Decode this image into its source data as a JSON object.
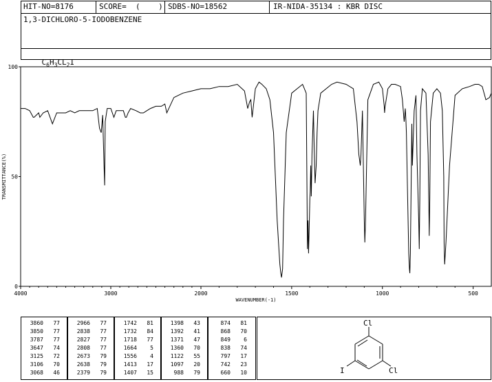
{
  "header": {
    "hit_no": "HIT-NO=8176",
    "score": "SCORE=  (    )",
    "sdbs_no": "SDBS-NO=18562",
    "ir_id": "IR-NIDA-35134 : KBR DISC",
    "compound_name": "1,3-DICHLORO-5-IODOBENZENE",
    "formula": "C6H3CL2I"
  },
  "chart_data": {
    "type": "line",
    "title": "",
    "xlabel": "WAVENUMBER(-1)",
    "ylabel": "TRANSMITTANCE(%)",
    "xlim": [
      4000,
      400
    ],
    "ylim": [
      0,
      100
    ],
    "x_ticks": [
      4000,
      3000,
      2000,
      1500,
      1000,
      500
    ],
    "y_ticks": [
      0,
      50,
      100
    ],
    "grid": false,
    "series": [
      {
        "x": [
          4000,
          3950,
          3900,
          3860,
          3850,
          3800,
          3787,
          3750,
          3700,
          3647,
          3600,
          3550,
          3500,
          3450,
          3400,
          3350,
          3300,
          3250,
          3200,
          3150,
          3125,
          3106,
          3090,
          3075,
          3068,
          3062,
          3040,
          3000,
          2966,
          2940,
          2900,
          2860,
          2838,
          2827,
          2808,
          2780,
          2720,
          2673,
          2638,
          2600,
          2560,
          2500,
          2440,
          2400,
          2379,
          2300,
          2200,
          2100,
          2000,
          1950,
          1900,
          1850,
          1800,
          1760,
          1742,
          1732,
          1725,
          1718,
          1700,
          1680,
          1664,
          1640,
          1620,
          1600,
          1580,
          1565,
          1560,
          1556,
          1550,
          1545,
          1530,
          1500,
          1470,
          1440,
          1420,
          1413,
          1410,
          1407,
          1404,
          1400,
          1398,
          1395,
          1392,
          1388,
          1380,
          1375,
          1371,
          1365,
          1360,
          1355,
          1340,
          1310,
          1280,
          1250,
          1200,
          1160,
          1140,
          1130,
          1125,
          1122,
          1118,
          1110,
          1100,
          1097,
          1093,
          1080,
          1050,
          1020,
          1000,
          990,
          988,
          985,
          970,
          950,
          930,
          900,
          890,
          880,
          874,
          870,
          868,
          862,
          855,
          851,
          849,
          846,
          840,
          838,
          835,
          825,
          815,
          810,
          800,
          797,
          794,
          790,
          780,
          760,
          748,
          744,
          742,
          739,
          735,
          720,
          700,
          680,
          670,
          662,
          660,
          657,
          650,
          630,
          600,
          560,
          520,
          490,
          470,
          450,
          430,
          410,
          400
        ],
        "y": [
          81,
          81,
          80,
          77,
          77,
          79,
          77,
          79,
          80,
          74,
          79,
          79,
          79,
          80,
          79,
          80,
          80,
          80,
          80,
          81,
          72,
          70,
          78,
          55,
          46,
          75,
          81,
          81,
          77,
          80,
          80,
          80,
          77,
          77,
          79,
          81,
          80,
          79,
          79,
          80,
          81,
          82,
          82,
          83,
          79,
          86,
          88,
          89,
          90,
          90,
          91,
          91,
          92,
          89,
          81,
          84,
          85,
          77,
          90,
          93,
          92,
          90,
          85,
          70,
          30,
          10,
          6,
          4,
          8,
          30,
          70,
          88,
          90,
          92,
          88,
          17,
          30,
          15,
          25,
          40,
          43,
          55,
          41,
          60,
          80,
          60,
          47,
          55,
          70,
          80,
          88,
          90,
          92,
          93,
          92,
          90,
          75,
          60,
          57,
          55,
          60,
          80,
          30,
          20,
          30,
          85,
          92,
          93,
          90,
          82,
          79,
          82,
          90,
          92,
          92,
          91,
          85,
          75,
          81,
          75,
          70,
          45,
          15,
          8,
          6,
          15,
          60,
          74,
          55,
          80,
          87,
          60,
          30,
          17,
          40,
          80,
          90,
          88,
          60,
          35,
          23,
          40,
          75,
          88,
          90,
          88,
          80,
          50,
          20,
          10,
          20,
          55,
          87,
          90,
          91,
          92,
          92,
          91,
          85,
          86,
          88
        ]
      }
    ],
    "peak_table": [
      {
        "wavenumber": [
          3860,
          3850,
          3787,
          3647,
          3125,
          3106,
          3068
        ],
        "transmittance": [
          77,
          77,
          77,
          74,
          72,
          70,
          46
        ]
      },
      {
        "wavenumber": [
          2966,
          2838,
          2827,
          2808,
          2673,
          2638,
          2379
        ],
        "transmittance": [
          77,
          77,
          77,
          77,
          79,
          79,
          79
        ]
      },
      {
        "wavenumber": [
          1742,
          1732,
          1718,
          1664,
          1556,
          1413,
          1407
        ],
        "transmittance": [
          81,
          84,
          77,
          5,
          4,
          17,
          15
        ]
      },
      {
        "wavenumber": [
          1398,
          1392,
          1371,
          1360,
          1122,
          1097,
          988
        ],
        "transmittance": [
          43,
          41,
          47,
          70,
          55,
          20,
          79
        ]
      },
      {
        "wavenumber": [
          874,
          868,
          849,
          838,
          797,
          742,
          660
        ],
        "transmittance": [
          81,
          70,
          6,
          74,
          17,
          23,
          10
        ]
      }
    ]
  },
  "structure": {
    "atom_cl_top": "Cl",
    "atom_i": "I",
    "atom_cl_right": "Cl"
  }
}
